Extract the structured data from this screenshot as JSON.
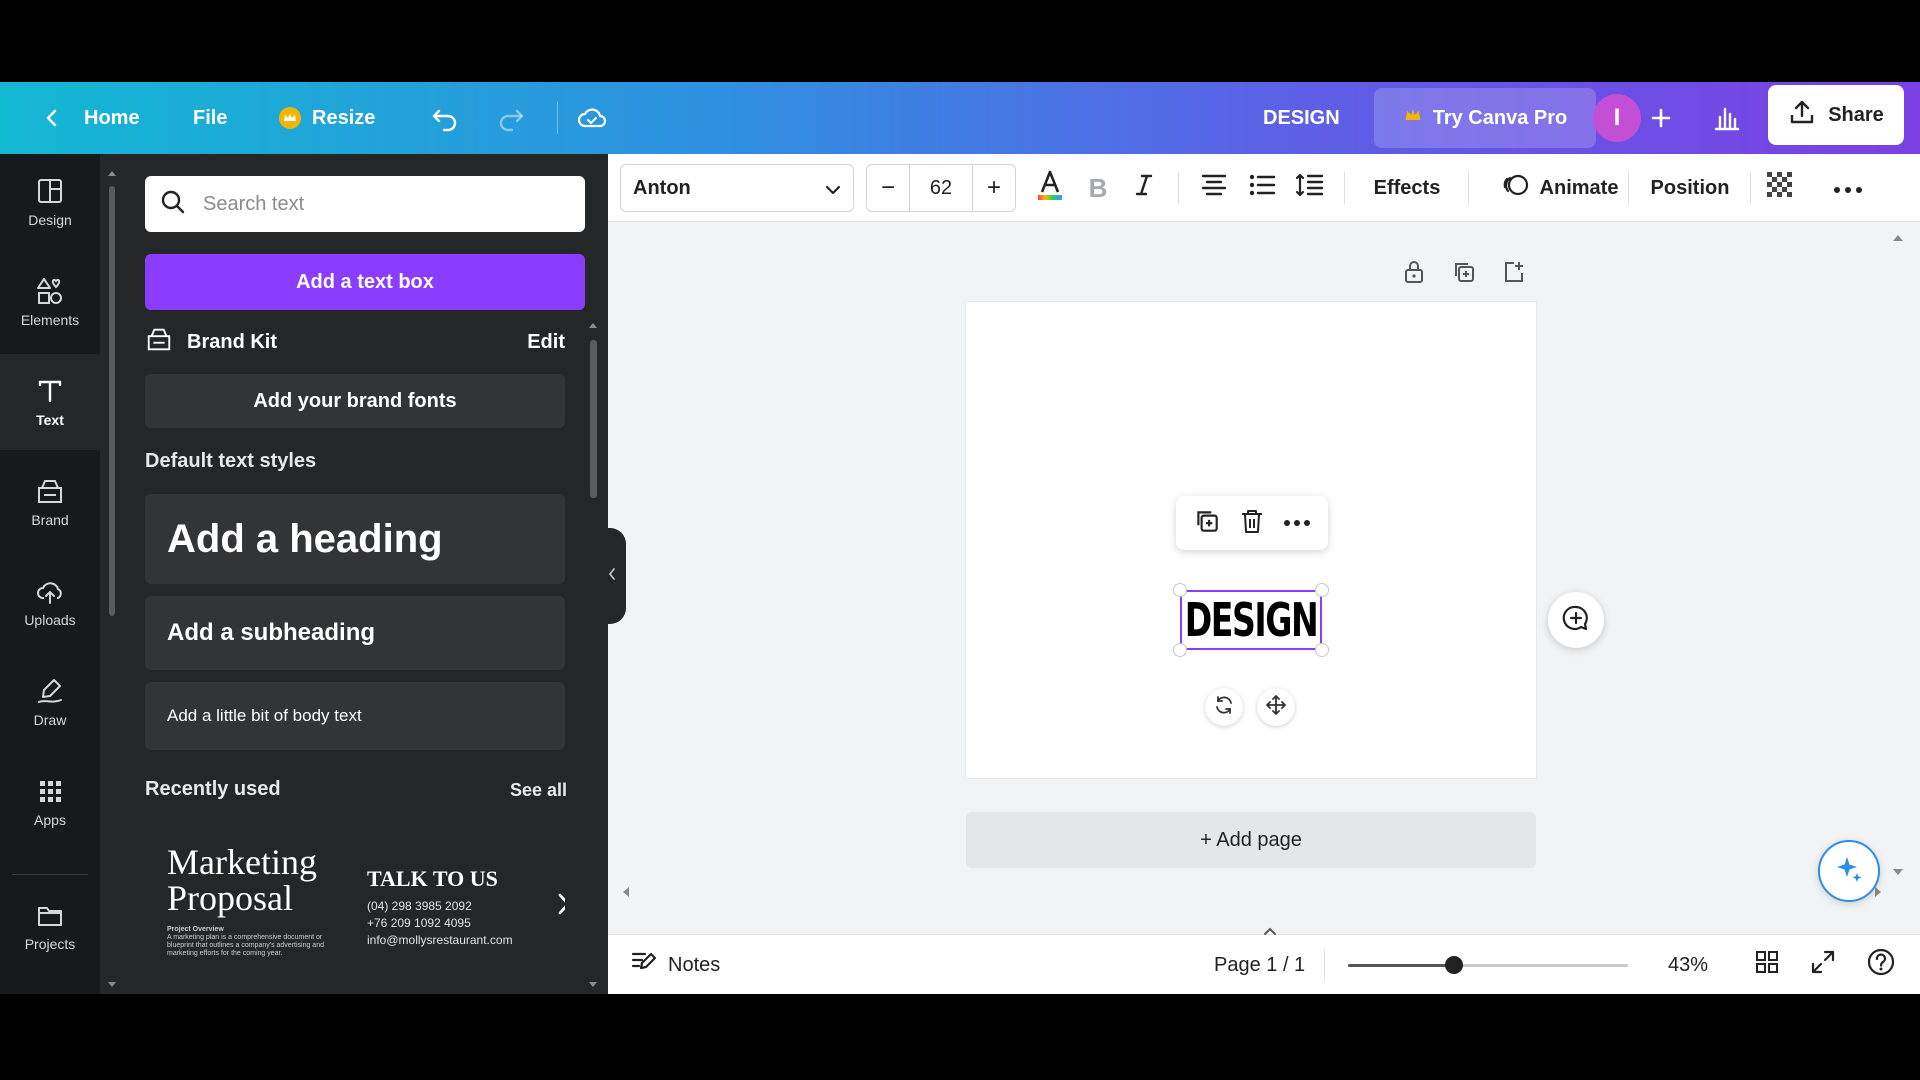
{
  "topbar": {
    "home_label": "Home",
    "file_label": "File",
    "resize_label": "Resize",
    "design_title": "DESIGN",
    "try_pro_label": "Try Canva Pro",
    "avatar_initial": "I",
    "share_label": "Share"
  },
  "rail": {
    "items": [
      {
        "label": "Design"
      },
      {
        "label": "Elements"
      },
      {
        "label": "Text"
      },
      {
        "label": "Brand"
      },
      {
        "label": "Uploads"
      },
      {
        "label": "Draw"
      },
      {
        "label": "Apps"
      },
      {
        "label": "Projects"
      }
    ]
  },
  "panel": {
    "search_placeholder": "Search text",
    "add_textbox_label": "Add a text box",
    "brand_kit_label": "Brand Kit",
    "edit_label": "Edit",
    "brand_fonts_label": "Add your brand fonts",
    "default_styles_title": "Default text styles",
    "heading_label": "Add a heading",
    "subheading_label": "Add a subheading",
    "body_label": "Add a little bit of body text",
    "recently_used_title": "Recently used",
    "see_all_label": "See all",
    "recent": [
      {
        "title": "Marketing Proposal",
        "subtitle": "Project Overview",
        "body": "A marketing plan is a comprehensive document or blueprint that outlines a company's advertising and marketing efforts for the coming year."
      },
      {
        "title": "TALK TO US",
        "lines": [
          "(04) 298 3985 2092",
          "+76 209 1092 4095",
          "info@mollysrestaurant.com"
        ]
      }
    ]
  },
  "toolbar": {
    "font_name": "Anton",
    "font_size": "62",
    "minus": "−",
    "plus": "+",
    "effects_label": "Effects",
    "animate_label": "Animate",
    "position_label": "Position"
  },
  "canvas": {
    "selected_text": "DESIGN",
    "add_page_label": "+ Add page"
  },
  "bottombar": {
    "notes_label": "Notes",
    "page_indicator": "Page 1 / 1",
    "zoom_label": "43%",
    "zoom_fraction": 0.38
  },
  "colors": {
    "accent": "#8b3dff",
    "topbar_start": "#13b8d3",
    "topbar_end": "#7b3fe4",
    "panel_bg": "#252627"
  }
}
